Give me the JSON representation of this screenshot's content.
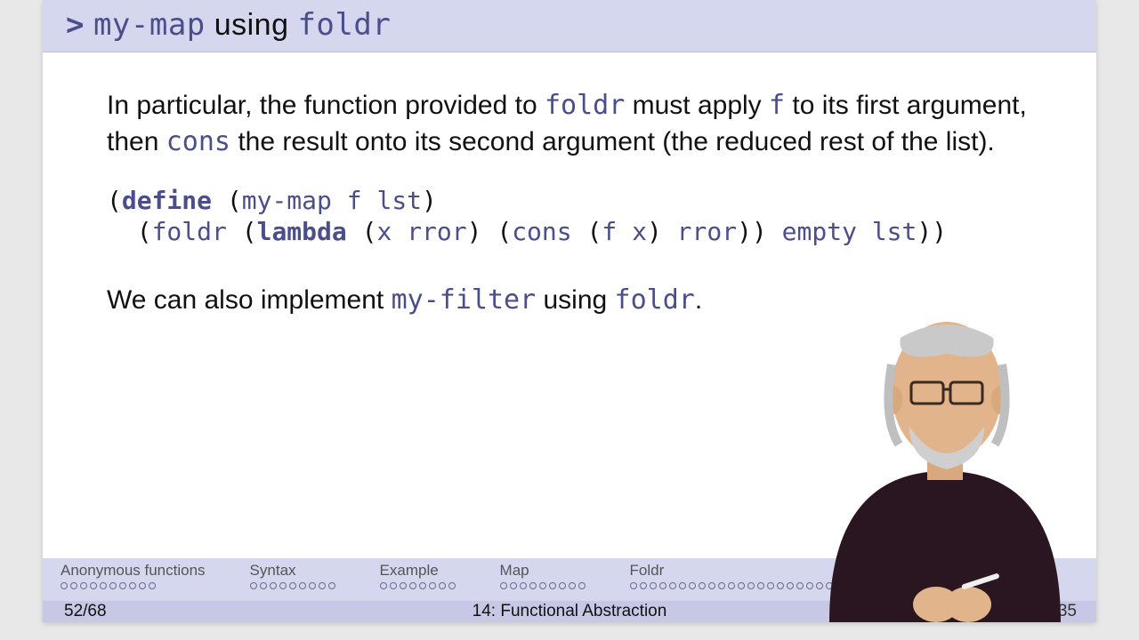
{
  "title": {
    "prompt": ">",
    "code1": "my-map",
    "using": " using ",
    "code2": "foldr"
  },
  "para1": {
    "t1": "In particular, the function provided to ",
    "c1": "foldr",
    "t2": " must apply ",
    "c2": "f",
    "t3": " to its first argument, then ",
    "c3": "cons",
    "t4": " the result onto its second argument (the reduced rest of the list)."
  },
  "code": {
    "l1a": "(",
    "l1kw": "define",
    "l1b": " (",
    "l1fn1": "my-map",
    "l1c": " ",
    "l1fn2": "f",
    "l1d": " ",
    "l1fn3": "lst",
    "l1e": ")",
    "l2a": "  (",
    "l2fn1": "foldr",
    "l2b": " (",
    "l2kw": "lambda",
    "l2c": " (",
    "l2fn2": "x",
    "l2d": " ",
    "l2fn3": "rror",
    "l2e": ") (",
    "l2fn4": "cons",
    "l2f": " (",
    "l2fn5": "f",
    "l2g": " ",
    "l2fn6": "x",
    "l2h": ") ",
    "l2fn7": "rror",
    "l2i": ")) ",
    "l2fn8": "empty",
    "l2j": " ",
    "l2fn9": "lst",
    "l2k": "))"
  },
  "para2": {
    "t1": "We can also implement ",
    "c1": "my-filter",
    "t2": " using ",
    "c2": "foldr",
    "t3": "."
  },
  "nav": {
    "sections": [
      {
        "label": "Anonymous functions",
        "total": 10,
        "current": 0
      },
      {
        "label": "Syntax",
        "total": 9,
        "current": 0
      },
      {
        "label": "Example",
        "total": 8,
        "current": 0
      },
      {
        "label": "Map",
        "total": 9,
        "current": 0
      },
      {
        "label": "Foldr",
        "total": 32,
        "current": 26
      }
    ]
  },
  "footer": {
    "page": "52/68",
    "lecture": "14: Functional Abstraction",
    "time": "1:35"
  }
}
